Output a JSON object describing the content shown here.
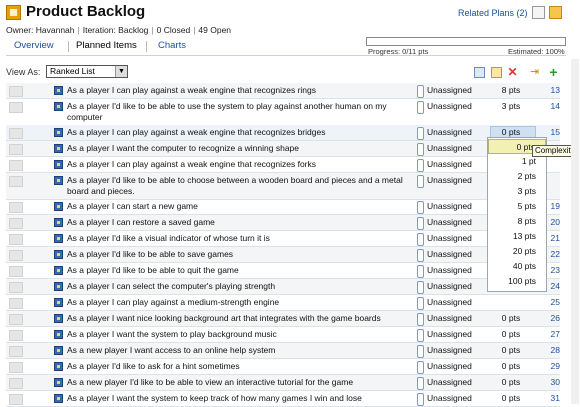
{
  "header": {
    "title": "Product Backlog",
    "owner_label": "Owner: Havannah",
    "iteration_label": "Iteration: Backlog",
    "closed_label": "0 Closed",
    "open_label": "49 Open",
    "related_plans": "Related Plans (2)"
  },
  "tabs": [
    {
      "label": "Overview"
    },
    {
      "label": "Planned Items"
    },
    {
      "label": "Charts"
    }
  ],
  "progress": {
    "text": "Progress: 0/11 pts",
    "estimated": "Estimated: 100%",
    "fraction": 0
  },
  "view": {
    "label": "View As:",
    "selected": "Ranked List"
  },
  "stories": [
    {
      "title": "As a player I can play against a weak engine that recognizes rings",
      "owner": "Unassigned",
      "points": "8 pts",
      "rank": "13"
    },
    {
      "title": "As a player I'd like to be able to use the system to play against another human on my computer",
      "owner": "Unassigned",
      "points": "3 pts",
      "rank": "14"
    },
    {
      "title": "As a player I can play against a weak engine that recognizes bridges",
      "owner": "Unassigned",
      "points": "0 pts",
      "rank": "15"
    },
    {
      "title": "As a player I want the computer to recognize a winning shape",
      "owner": "Unassigned",
      "points": "",
      "rank": ""
    },
    {
      "title": "As a player I can play against a weak engine that recognizes forks",
      "owner": "Unassigned",
      "points": "",
      "rank": ""
    },
    {
      "title": "As a player I'd like to be able to choose between a wooden board and pieces and a metal board and pieces.",
      "owner": "Unassigned",
      "points": "",
      "rank": ""
    },
    {
      "title": "As a player I can start a new game",
      "owner": "Unassigned",
      "points": "",
      "rank": "19"
    },
    {
      "title": "As a player I can restore a saved game",
      "owner": "Unassigned",
      "points": "",
      "rank": "20"
    },
    {
      "title": "As a player I'd like a visual indicator of whose turn it is",
      "owner": "Unassigned",
      "points": "",
      "rank": "21"
    },
    {
      "title": "As a player I'd like to be able to save games",
      "owner": "Unassigned",
      "points": "",
      "rank": "22"
    },
    {
      "title": "As a player I'd like to be able to quit the game",
      "owner": "Unassigned",
      "points": "",
      "rank": "23"
    },
    {
      "title": "As a player I can select the computer's playing strength",
      "owner": "Unassigned",
      "points": "",
      "rank": "24"
    },
    {
      "title": "As a player I can play against a medium-strength engine",
      "owner": "Unassigned",
      "points": "",
      "rank": "25"
    },
    {
      "title": "As a player I want nice looking background art that integrates with the game boards",
      "owner": "Unassigned",
      "points": "0 pts",
      "rank": "26"
    },
    {
      "title": "As a player I want the system to play background music",
      "owner": "Unassigned",
      "points": "0 pts",
      "rank": "27"
    },
    {
      "title": "As a new player I want access to an online help system",
      "owner": "Unassigned",
      "points": "0 pts",
      "rank": "28"
    },
    {
      "title": "As a player I'd like to ask for a hint sometimes",
      "owner": "Unassigned",
      "points": "0 pts",
      "rank": "29"
    },
    {
      "title": "As a new player I'd like to be able to view an interactive tutorial for the game",
      "owner": "Unassigned",
      "points": "0 pts",
      "rank": "30"
    },
    {
      "title": "As a player I want the system to keep track of how many games I win and lose",
      "owner": "Unassigned",
      "points": "0 pts",
      "rank": "31"
    }
  ],
  "complexity_dropdown": {
    "options": [
      "0 pts",
      "1 pt",
      "2 pts",
      "3 pts",
      "5 pts",
      "8 pts",
      "13 pts",
      "20 pts",
      "40 pts",
      "100 pts"
    ],
    "tooltip": "Complexity"
  },
  "colors": {
    "link": "#1a4f9c",
    "story_icon": "#3b66b0",
    "estimate_highlight": "#cfe0f3",
    "dropdown_highlight": "#f3f0b4"
  }
}
